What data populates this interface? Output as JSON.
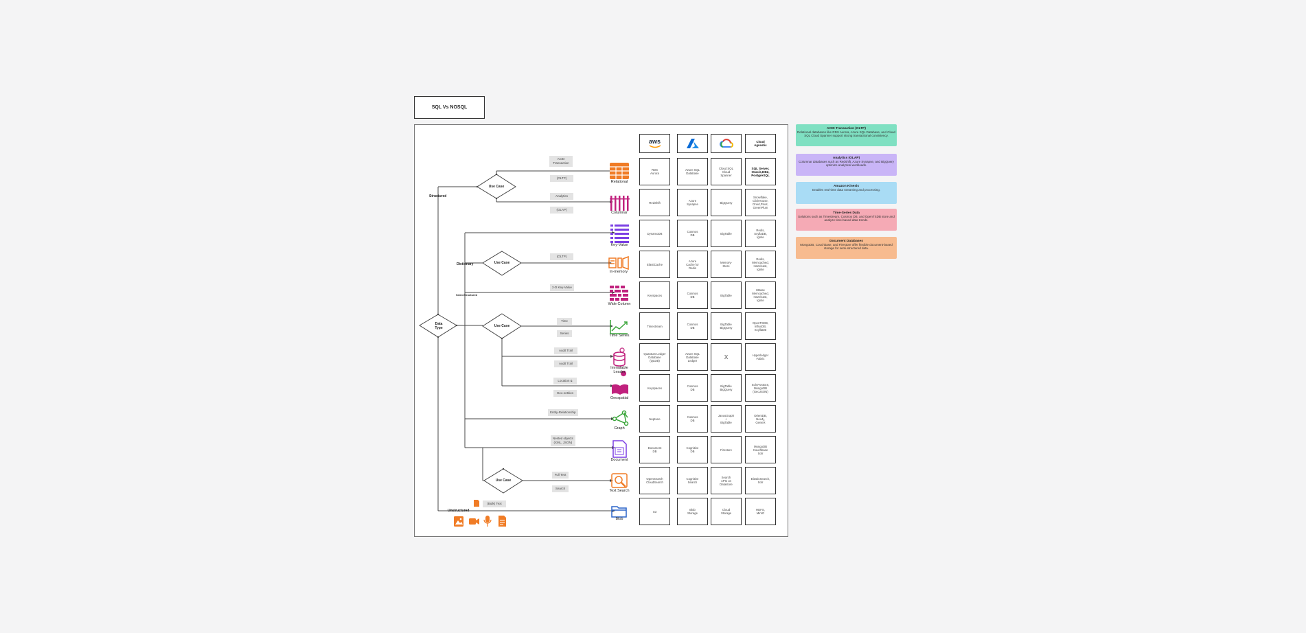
{
  "title": "SQL Vs NOSQL",
  "decision": {
    "data_type": "Data\nType",
    "use_case": "Use Case",
    "branches": {
      "structured": "Structured",
      "dictionary": "Dictionary",
      "semi": "Semi-Structured",
      "unstructured": "Unstructured"
    }
  },
  "edge_labels": {
    "acid": "ACID\nTransaction",
    "oltp1": "(OLTP)",
    "analytics": "Analytics",
    "olap": "(OLAP)",
    "oltp2": "(OLTP)",
    "kv2d": "2-D Key-Value",
    "time": "Time",
    "series": "Series",
    "audit1": "Audit Trail",
    "audit2": "Audit Trail",
    "location": "Location &",
    "geo": "Geo-entities",
    "entity": "Entity-Relationship",
    "nested": "Nested objects\n(XML, JSON)",
    "fulltext": "Full Text",
    "search": "Search",
    "bulk": "(Bulk) Text"
  },
  "types": [
    {
      "icon": "relational-table-icon",
      "label": "Relational"
    },
    {
      "icon": "columnar-icon",
      "label": "Columnar"
    },
    {
      "icon": "key-value-icon",
      "label": "Key-Value"
    },
    {
      "icon": "in-memory-icon",
      "label": "In-memory"
    },
    {
      "icon": "wide-column-icon",
      "label": "Wide Column"
    },
    {
      "icon": "time-series-icon",
      "label": "Time Series"
    },
    {
      "icon": "ledger-icon",
      "label": "Immutable\nLeader"
    },
    {
      "icon": "geospatial-icon",
      "label": "Geospatial"
    },
    {
      "icon": "graph-icon",
      "label": "Graph"
    },
    {
      "icon": "document-icon",
      "label": "Document"
    },
    {
      "icon": "text-search-icon",
      "label": "Text Search"
    },
    {
      "icon": "blob-icon",
      "label": "Blob"
    }
  ],
  "providers": [
    {
      "name": "aws",
      "icon": "aws-logo"
    },
    {
      "name": "",
      "icon": "azure-logo"
    },
    {
      "name": "",
      "icon": "google-cloud-logo"
    },
    {
      "name": "Cloud\nAgnostic",
      "icon": ""
    }
  ],
  "grid": [
    [
      "RDS\nAurora",
      "Azure SQL\nDatabase",
      "Cloud SQL\nCloud\nSpanner",
      "SQL Server,\nOracle,DB2,\nPostgreSQL"
    ],
    [
      "RedShift",
      "Azure\nSynapse",
      "BigQuery",
      "Snowflake,\nClickHouse,\nDruid,Pinot,\nGreenPlum"
    ],
    [
      "DynamoDB",
      "Cosmos\nDB",
      "BigTable",
      "Redis,\nScyllaDB,\nIgnite"
    ],
    [
      "ElastiCache",
      "Azure\nCache for\nRedis",
      "Memory-\nStore",
      "Redis,\nMemcached,\nHazelcast,\nIgnite"
    ],
    [
      "Keyspaces",
      "Cosmos\nDB",
      "BigTable",
      "HBase\nMemcached,\nHazelcast,\nIgnite"
    ],
    [
      "Timestream",
      "Cosmos\nDB",
      "BigTable\nBigQuery",
      "OpenTSDB,\nInfluxDB,\nScyllaDB"
    ],
    [
      "Quantum Ledger\nDatabase\n(QLDB)",
      "Azure SQL\nDatabase\nLedger",
      "X",
      "Hyperledger\nFabric"
    ],
    [
      "Keyspaces",
      "Cosmos\nDB",
      "BigTable\nBigQuery",
      "Solr,PostGIS,\nMongoDB\n(GeoJSON)"
    ],
    [
      "Neptune",
      "Cosmos\nDB",
      "JanusGraph\n+\nBigTable",
      "OrientDB,\nNeo4j,\nGenieX"
    ],
    [
      "Document\nDB",
      "Cognitive\nDB",
      "Firestore",
      "MongoDB\nCouchbase\nSolr"
    ],
    [
      "OpenSearch\nCloudSearch",
      "Cognitive\nSearch",
      "Search\nAPIs on\nDatastore",
      "ElasticSearch,\nSolr"
    ],
    [
      "S3",
      "Blob\nStorage",
      "Cloud\nStorage",
      "HDFS,\nMinIO"
    ]
  ],
  "legend": [
    {
      "title": "ACID Transaction (OLTP)",
      "text": "Relational databases like RDS Aurora, Azure SQL Database, and Cloud SQL Cloud Spanner support strong transactional consistency.",
      "color": "#7fe0c2"
    },
    {
      "title": "Analytics (OLAP)",
      "text": "Columnar databases such as Redshift, Azure Synapse, and BigQuery optimize analytical workloads.",
      "color": "#c9b5f7"
    },
    {
      "title": "Amazon Kinesis",
      "text": "Enables real-time data streaming and processing.",
      "color": "#a9dcf5"
    },
    {
      "title": "Time-Series Data",
      "text": "Solutions such as Timestream, Cosmos DB, and OpenTSDB store and analyze time-based data trends.",
      "color": "#f5aab5"
    },
    {
      "title": "Document Databases",
      "text": "MongoDB, Couchbase, and Firestore offer flexible document-based storage for semi-structured data.",
      "color": "#f7bb8f"
    }
  ],
  "colors": {
    "orange": "#f07c26",
    "purple": "#7b3fe4",
    "magenta": "#c0217d",
    "green": "#3aa53a",
    "blue": "#2a64c9"
  }
}
